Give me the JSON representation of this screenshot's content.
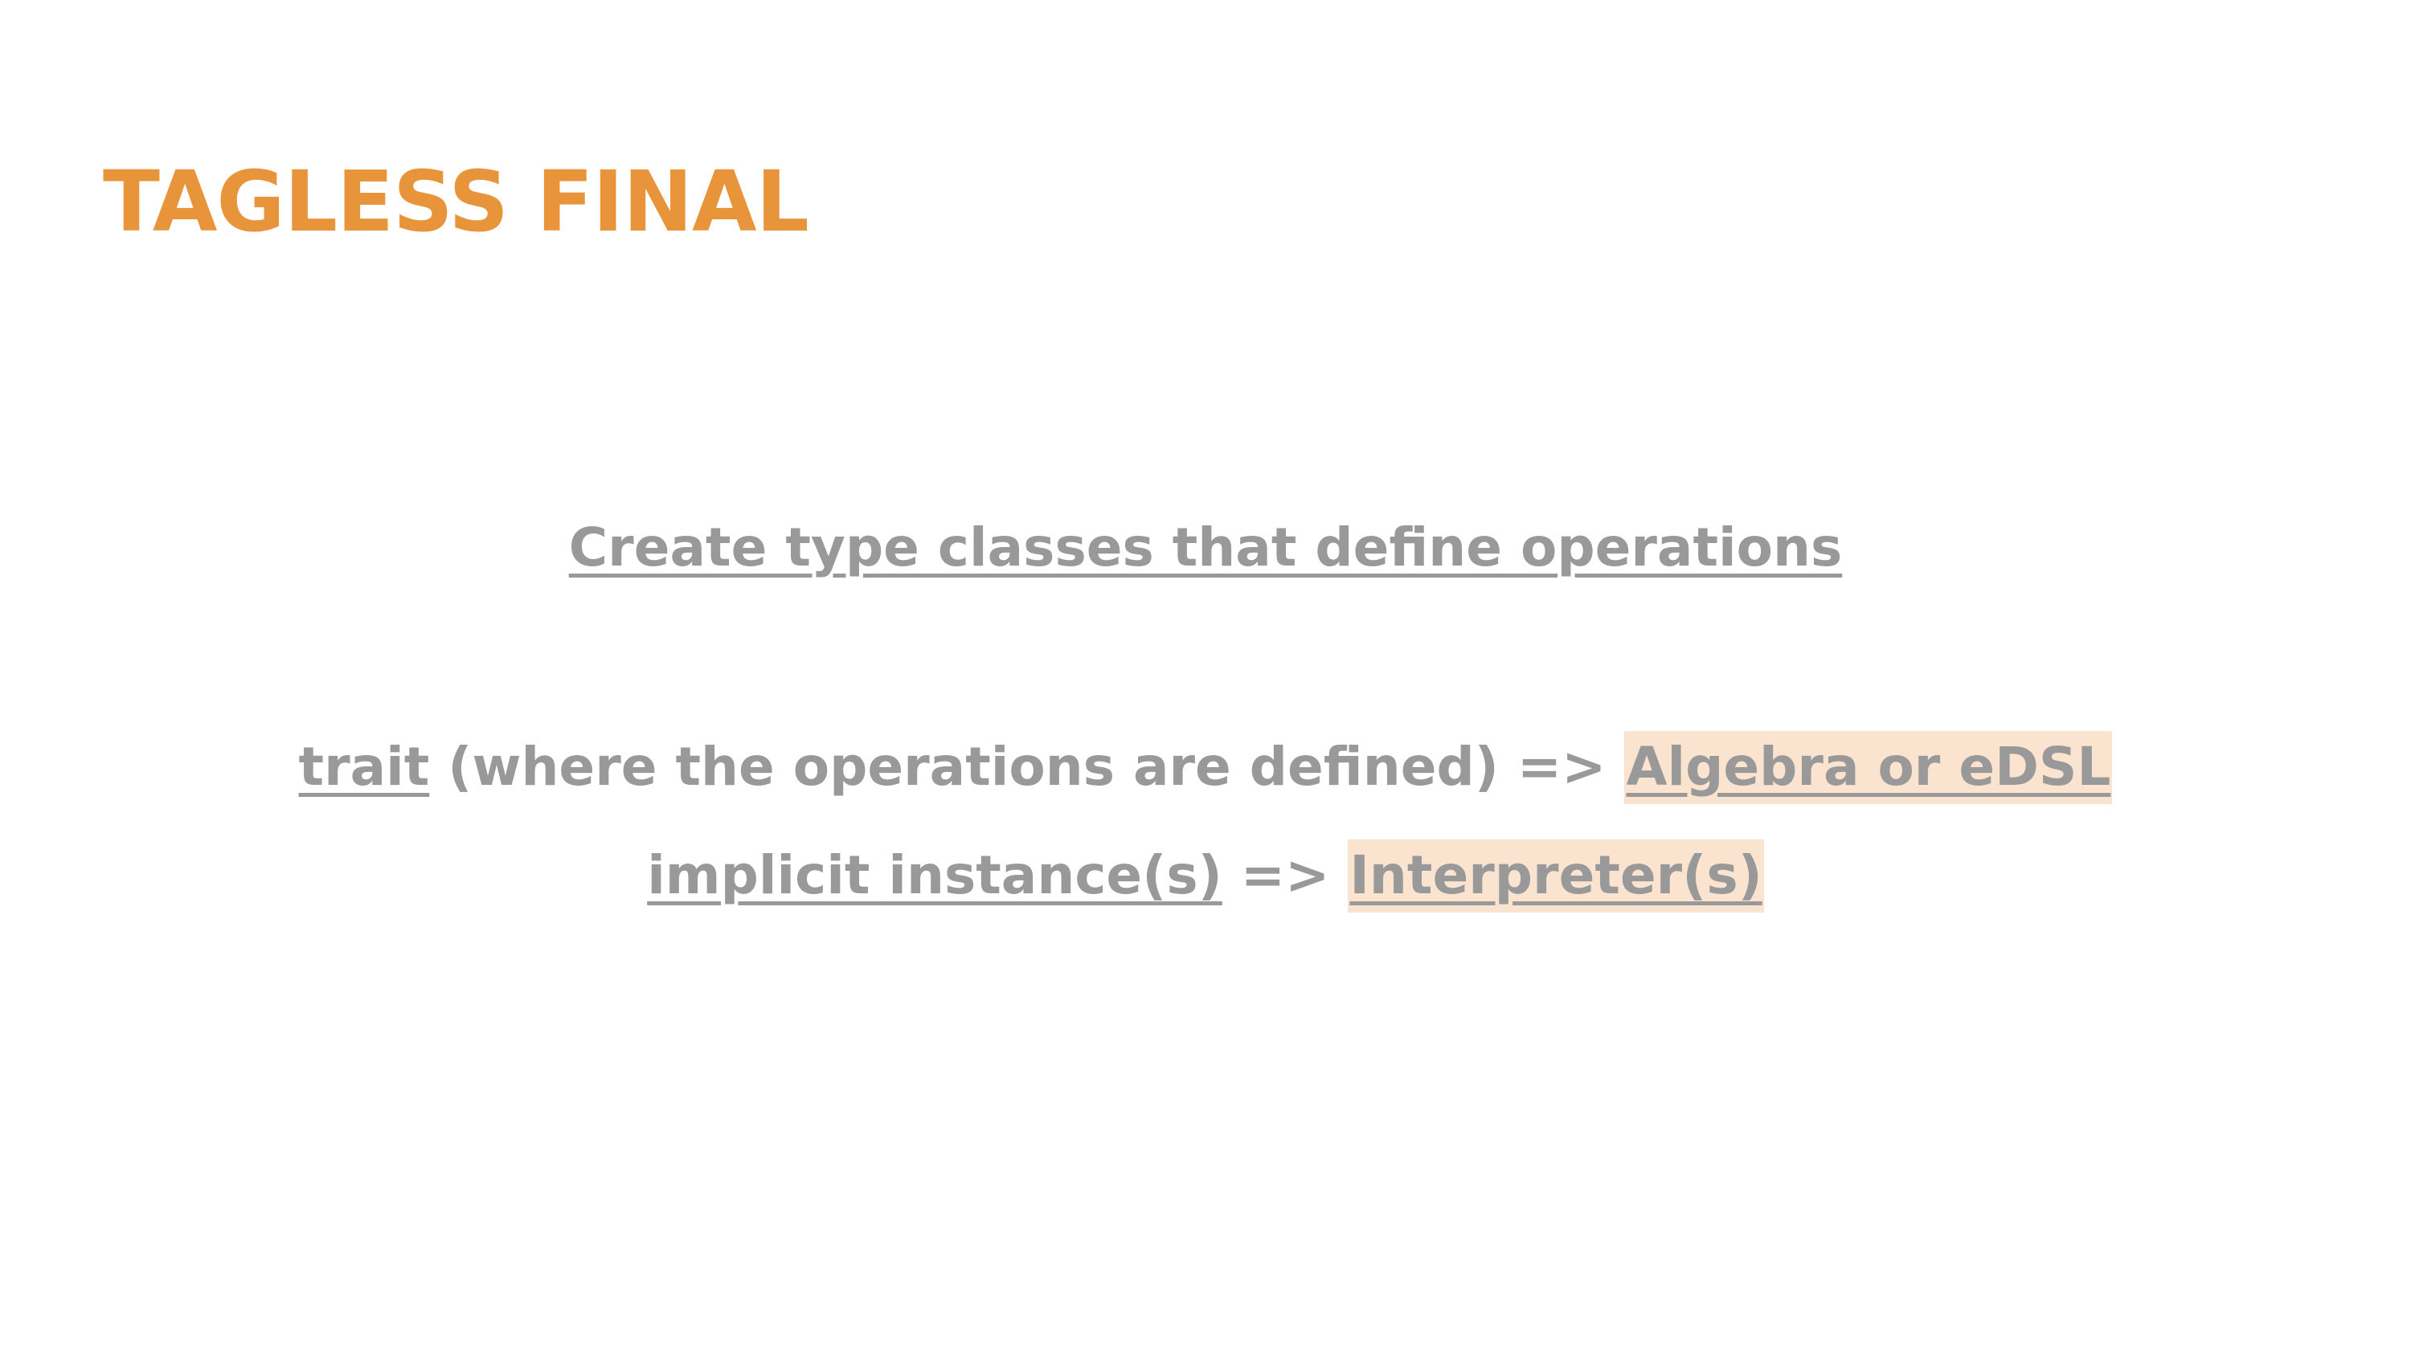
{
  "slide": {
    "title": "TAGLESS FINAL",
    "heading": "Create type classes that define operations",
    "row1": {
      "term": "trait",
      "description": " (where the operations are defined) => ",
      "result": "Algebra or eDSL"
    },
    "row2": {
      "term": "implicit instance(s)",
      "arrow": " => ",
      "result": "Interpreter(s)"
    },
    "colors": {
      "title": "#e8943a",
      "body_text": "#999999",
      "highlight": "#fae3cf",
      "background": "#ffffff"
    }
  }
}
